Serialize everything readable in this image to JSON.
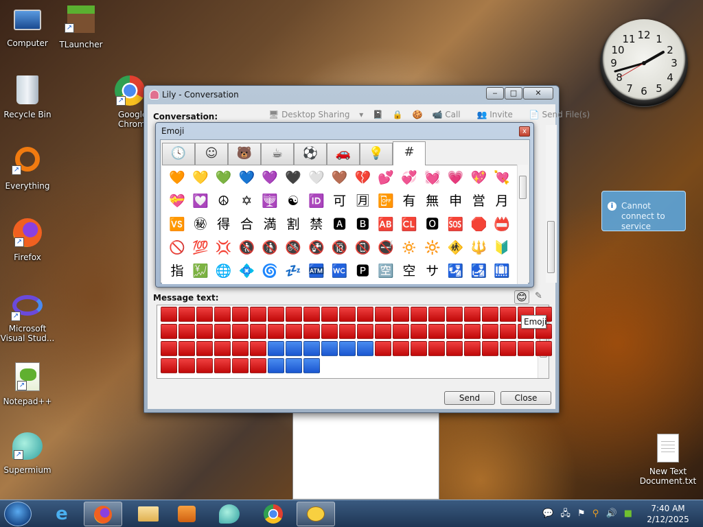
{
  "desktop": {
    "icons": [
      {
        "label": "Computer",
        "icon": "computer-icon"
      },
      {
        "label": "TLauncher",
        "icon": "tlauncher-icon"
      },
      {
        "label": "Recycle Bin",
        "icon": "recycle-bin-icon"
      },
      {
        "label": "Google Chrome",
        "icon": "chrome-icon"
      },
      {
        "label": "Everything",
        "icon": "everything-icon"
      },
      {
        "label": "Firefox",
        "icon": "firefox-icon"
      },
      {
        "label": "Microsoft Visual Stud...",
        "icon": "visual-studio-icon"
      },
      {
        "label": "Notepad++",
        "icon": "notepad-plus-plus-icon"
      },
      {
        "label": "Supermium",
        "icon": "supermium-icon"
      },
      {
        "label": "New Text Document.txt",
        "icon": "text-document-icon"
      }
    ],
    "clock_numbers": [
      "12",
      "1",
      "2",
      "3",
      "4",
      "5",
      "6",
      "7",
      "8",
      "9",
      "10",
      "11"
    ],
    "notification": "Cannot connect to service"
  },
  "conversation_window": {
    "title": "Lily - Conversation",
    "conversation_label": "Conversation:",
    "toolbar": {
      "desktop_sharing": "Desktop Sharing",
      "call": "Call",
      "invite": "Invite",
      "send_files": "Send File(s)"
    },
    "message_label": "Message text:",
    "send_button": "Send",
    "close_button": "Close",
    "emoji_tooltip": "Emoji"
  },
  "emoji_popup": {
    "title": "Emoji",
    "close_glyph": "x",
    "tabs": [
      {
        "icon": "clock-icon",
        "glyph": "🕓"
      },
      {
        "icon": "smiley-icon",
        "glyph": "☺"
      },
      {
        "icon": "bear-icon",
        "glyph": "🐻"
      },
      {
        "icon": "cup-icon",
        "glyph": "☕"
      },
      {
        "icon": "soccer-ball-icon",
        "glyph": "⚽"
      },
      {
        "icon": "car-icon",
        "glyph": "🚗"
      },
      {
        "icon": "lightbulb-icon",
        "glyph": "💡"
      },
      {
        "icon": "hash-symbol-icon",
        "glyph": "#"
      }
    ],
    "rows": [
      [
        "🧡",
        "💛",
        "💚",
        "💙",
        "💜",
        "🖤",
        "🤍",
        "🤎",
        "💔",
        "💕",
        "💞",
        "💓",
        "💗",
        "💖",
        "💘"
      ],
      [
        "💝",
        "💟",
        "☮",
        "✡",
        "🕎",
        "☯",
        "🆔",
        "可",
        "🈷",
        "📴",
        "有",
        "無",
        "申",
        "営",
        "月"
      ],
      [
        "🆚",
        "㊙",
        "得",
        "合",
        "満",
        "割",
        "禁",
        "🅰",
        "🅱",
        "🆎",
        "🆑",
        "🅾",
        "🆘",
        "🛑",
        "📛"
      ],
      [
        "🚫",
        "💯",
        "💢",
        "🚷",
        "🚯",
        "🚳",
        "🚱",
        "🔞",
        "📵",
        "🚭",
        "🔅",
        "🔆",
        "🚸",
        "🔱",
        "🔰"
      ],
      [
        "指",
        "💹",
        "🌐",
        "💠",
        "🌀",
        "💤",
        "🏧",
        "🚾",
        "🅿",
        "🈳",
        "空",
        "サ",
        "🛂",
        "🛃",
        "🛄"
      ]
    ]
  },
  "message_text": {
    "rows": [
      [
        "r",
        "r",
        "r",
        "r",
        "r",
        "r",
        "r",
        "r",
        "r",
        "r",
        "r",
        "r",
        "r",
        "r",
        "r",
        "r",
        "r",
        "r",
        "r",
        "r",
        "r",
        "r"
      ],
      [
        "r",
        "r",
        "r",
        "r",
        "r",
        "r",
        "r",
        "r",
        "r",
        "r",
        "r",
        "r",
        "r",
        "r",
        "r",
        "r",
        "r",
        "r",
        "r",
        "r",
        "r",
        "r"
      ],
      [
        "r",
        "r",
        "r",
        "r",
        "r",
        "r",
        "b",
        "b",
        "b",
        "b",
        "b",
        "b",
        "r",
        "r",
        "r",
        "r",
        "r",
        "r",
        "r",
        "r",
        "r",
        "r"
      ],
      [
        "r",
        "r",
        "r",
        "r",
        "r",
        "r",
        "b",
        "b",
        "b"
      ]
    ]
  },
  "taskbar": {
    "time": "7:40 AM",
    "date": "2/12/2025",
    "apps": [
      "start-orb",
      "internet-explorer",
      "firefox",
      "file-explorer",
      "media-player",
      "supermium",
      "chrome",
      "messenger"
    ]
  }
}
